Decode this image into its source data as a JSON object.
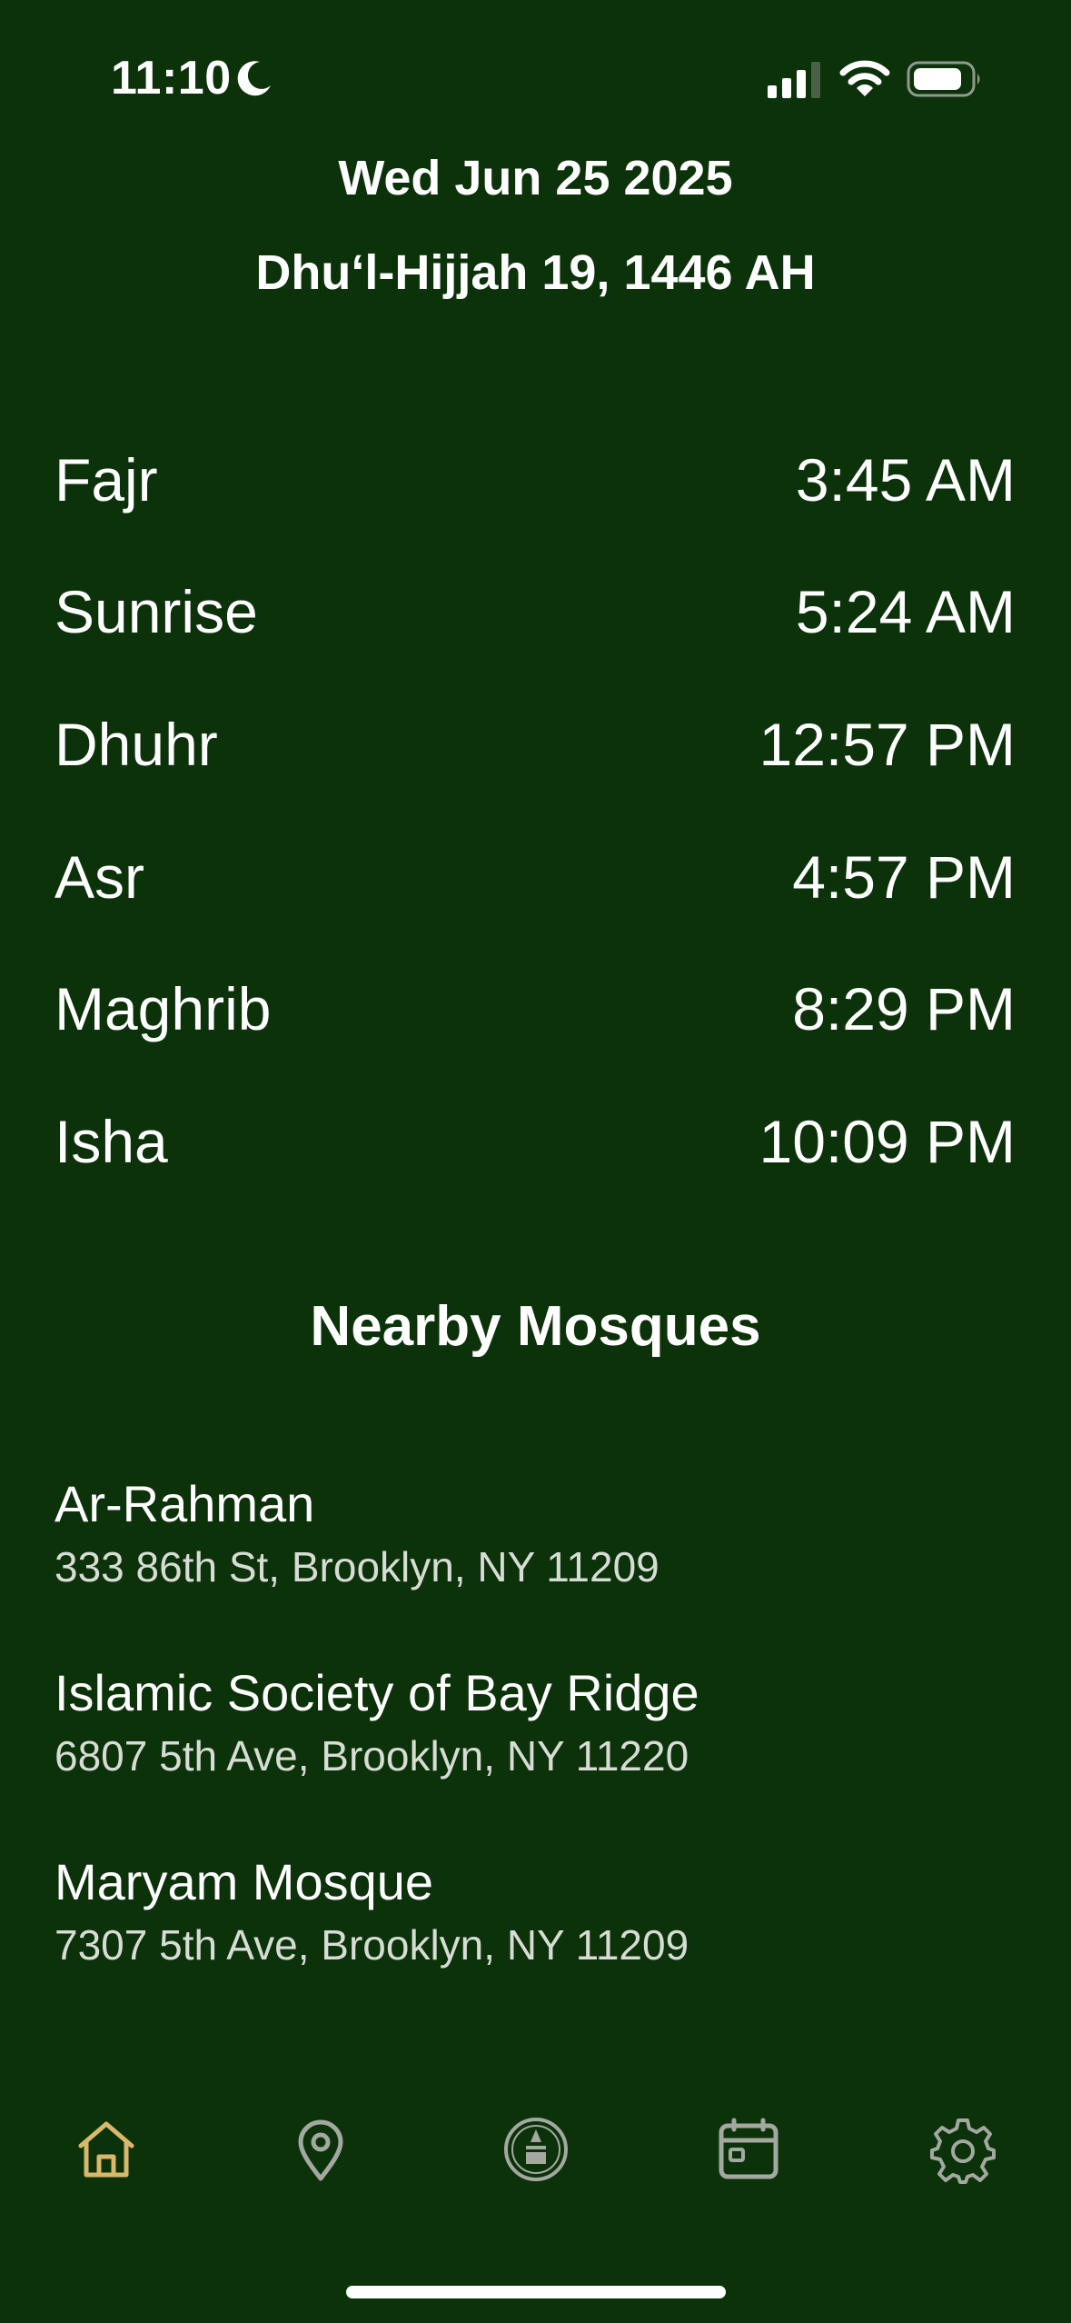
{
  "status_bar": {
    "time": "11:10",
    "focus_icon": "moon-icon",
    "signal_icon": "cellular-signal-icon",
    "wifi_icon": "wifi-icon",
    "battery_icon": "battery-icon"
  },
  "header": {
    "gregorian_date": "Wed Jun 25 2025",
    "hijri_date": "Dhuʻl-Hijjah 19, 1446 AH"
  },
  "prayers": [
    {
      "name": "Fajr",
      "time": "3:45 AM"
    },
    {
      "name": "Sunrise",
      "time": "5:24 AM"
    },
    {
      "name": "Dhuhr",
      "time": "12:57 PM"
    },
    {
      "name": "Asr",
      "time": "4:57 PM"
    },
    {
      "name": "Maghrib",
      "time": "8:29 PM"
    },
    {
      "name": "Isha",
      "time": "10:09 PM"
    }
  ],
  "nearby": {
    "title": "Nearby Mosques",
    "mosques": [
      {
        "name": "Ar-Rahman",
        "address": "333 86th St, Brooklyn, NY 11209"
      },
      {
        "name": "Islamic Society of Bay Ridge",
        "address": "6807 5th Ave, Brooklyn, NY 11220"
      },
      {
        "name": "Maryam Mosque",
        "address": "7307 5th Ave, Brooklyn, NY 11209"
      }
    ]
  },
  "tab_bar": {
    "tabs": [
      {
        "icon": "home-icon",
        "active": true
      },
      {
        "icon": "map-pin-icon",
        "active": false
      },
      {
        "icon": "qibla-compass-icon",
        "active": false
      },
      {
        "icon": "calendar-icon",
        "active": false
      },
      {
        "icon": "gear-icon",
        "active": false
      }
    ]
  },
  "colors": {
    "background": "#0c320a",
    "text": "#ffffff",
    "secondary_text": "#d7ddd5",
    "active_tab": "#d9b86a",
    "inactive_tab": "#a3a8a1"
  }
}
